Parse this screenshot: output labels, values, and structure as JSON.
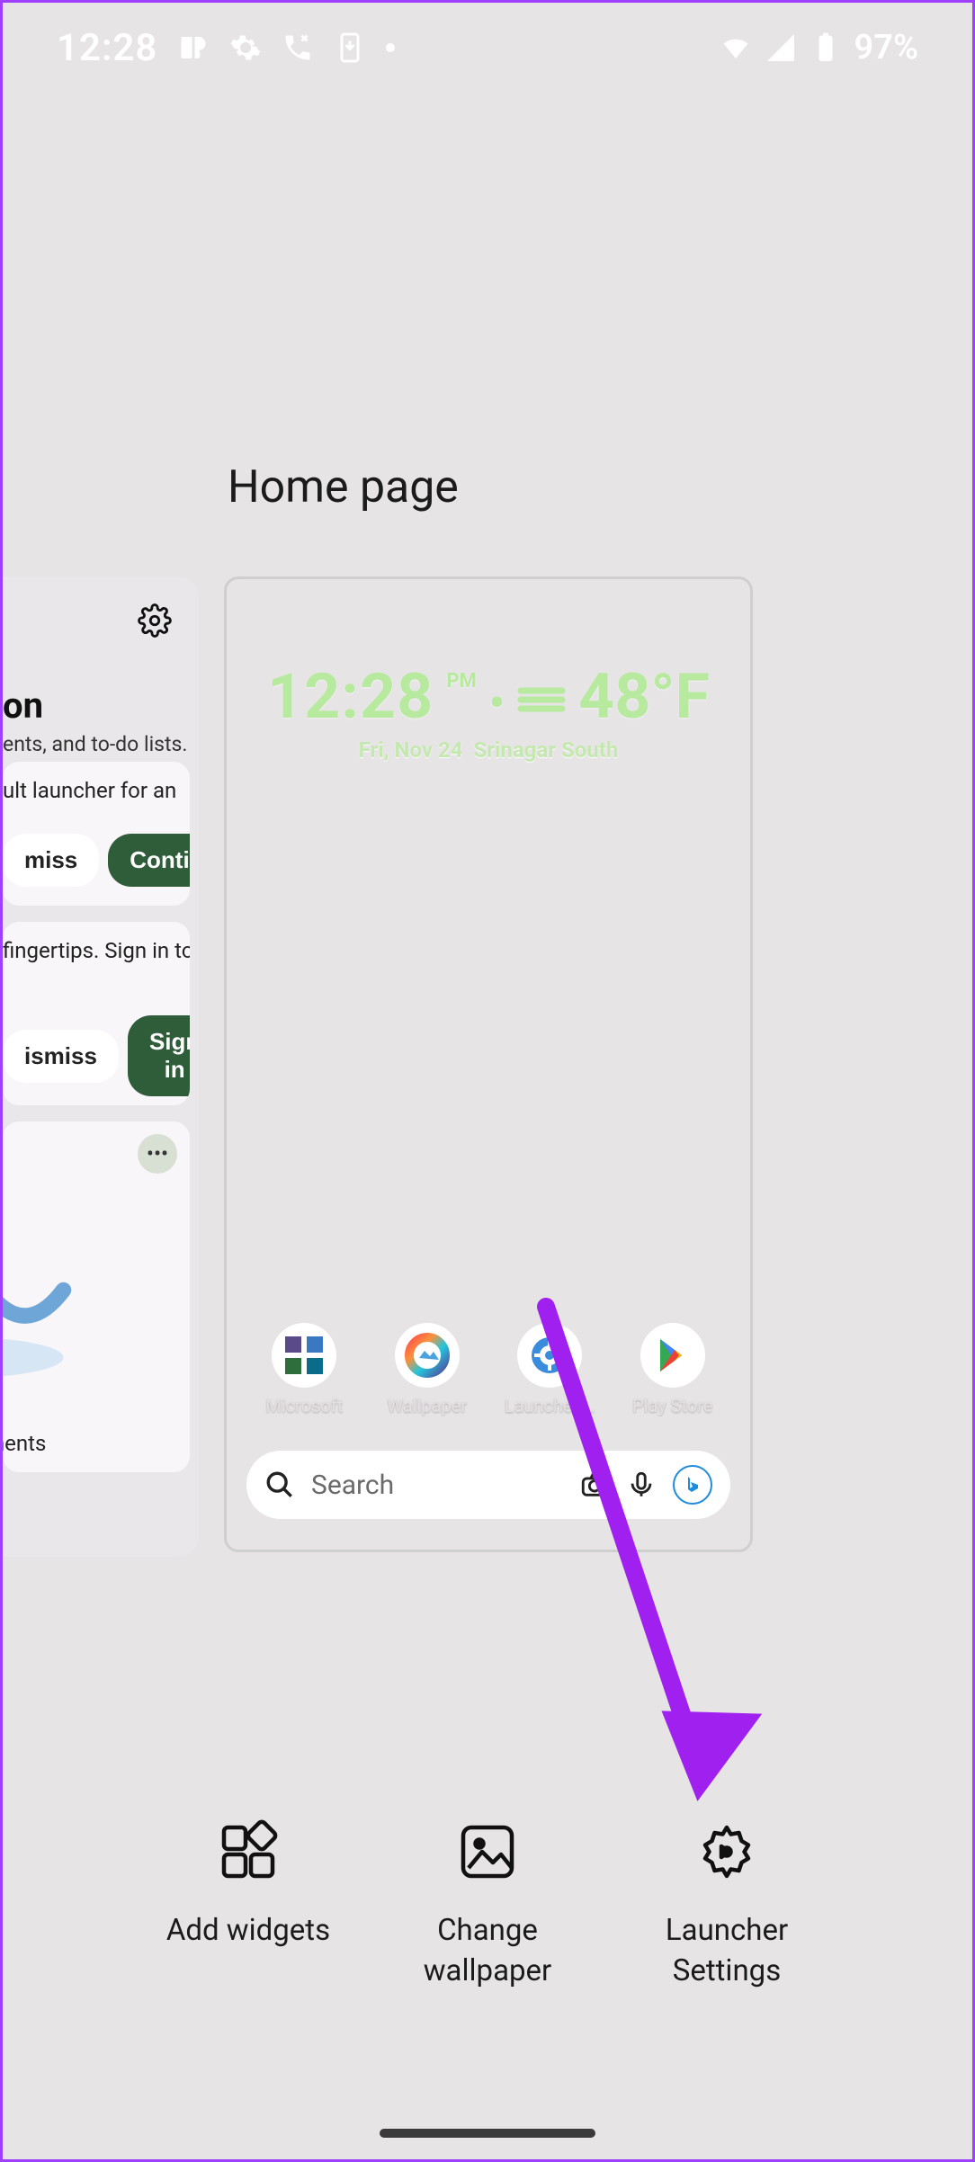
{
  "status": {
    "time": "12:28",
    "battery": "97%"
  },
  "page_title": "Home page",
  "feed": {
    "heading_suffix": "on",
    "subheading_suffix": "ents, and to-do lists.",
    "card1": {
      "line1": "ult launcher for an",
      "dismiss": "miss",
      "primary": "Continue"
    },
    "card2": {
      "line1": "fingertips. Sign in to",
      "dismiss": "ismiss",
      "primary": "Sign in"
    },
    "card3": {
      "footer": "ntments"
    }
  },
  "home": {
    "time": "12:28",
    "ampm": "PM",
    "sep": "•",
    "temp": "48°F",
    "date": "Fri, Nov 24",
    "location": "Srinagar South",
    "apps": [
      {
        "label": "Microsoft"
      },
      {
        "label": "Wallpaper"
      },
      {
        "label": "Launcher …"
      },
      {
        "label": "Play Store"
      }
    ],
    "search_placeholder": "Search"
  },
  "actions": {
    "widgets": "Add widgets",
    "wallpaper": "Change\nwallpaper",
    "settings": "Launcher\nSettings"
  }
}
